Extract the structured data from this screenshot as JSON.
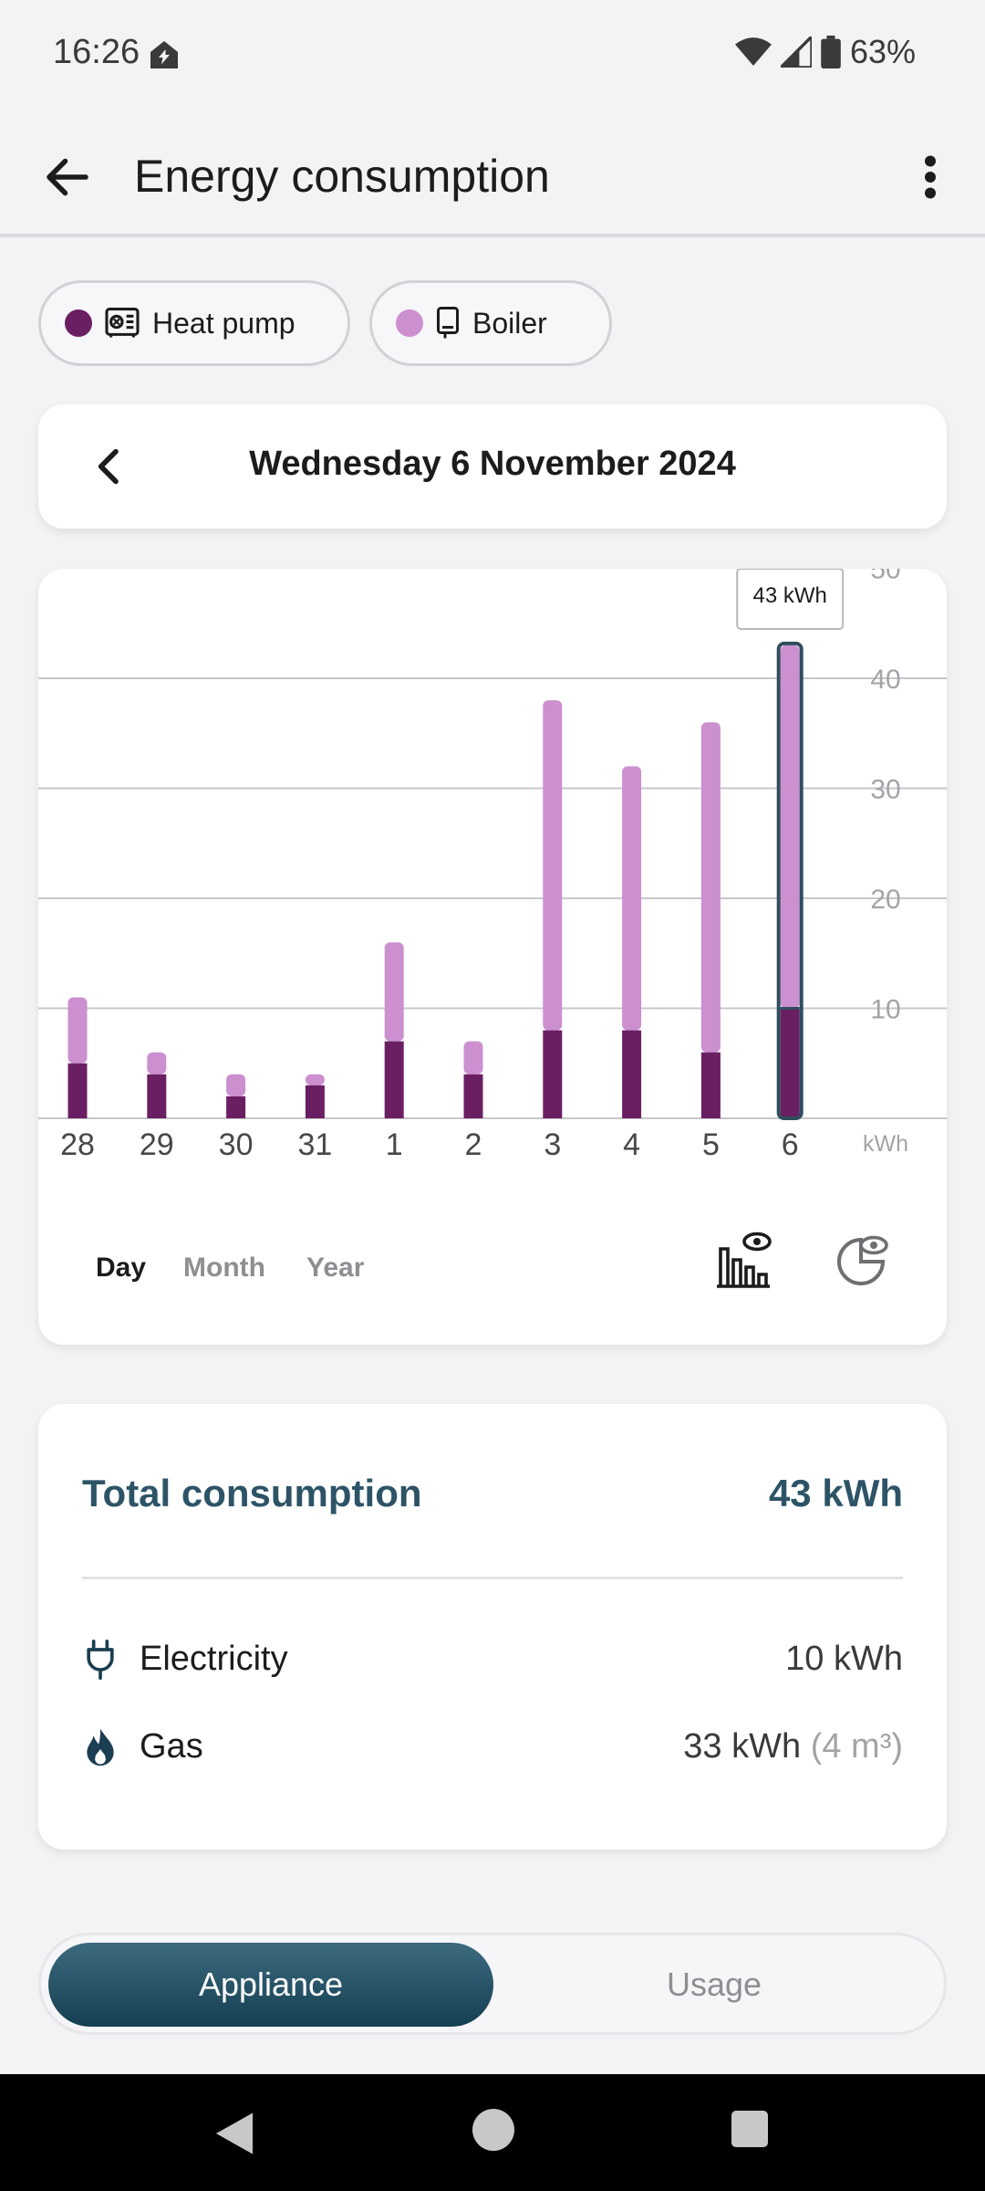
{
  "status_bar": {
    "time": "16:26",
    "battery": "63%",
    "icons": [
      "app-notification-icon",
      "wifi-icon",
      "signal-icon",
      "battery-icon"
    ]
  },
  "header": {
    "title": "Energy consumption",
    "icons": [
      "back-arrow-icon",
      "more-vert-icon"
    ]
  },
  "filters": [
    {
      "label": "Heat pump",
      "color": "#6b1f63",
      "icon": "heat-pump-icon"
    },
    {
      "label": "Boiler",
      "color": "#cc8fd0",
      "icon": "boiler-icon"
    }
  ],
  "date_nav": {
    "title": "Wednesday 6 November 2024"
  },
  "chart_data": {
    "type": "bar",
    "stacked": true,
    "categories": [
      "28",
      "29",
      "30",
      "31",
      "1",
      "2",
      "3",
      "4",
      "5",
      "6"
    ],
    "series": [
      {
        "name": "Heat pump",
        "color": "#6b1f63",
        "values": [
          5,
          4,
          2,
          3,
          7,
          4,
          8,
          8,
          6,
          10
        ]
      },
      {
        "name": "Boiler",
        "color": "#cc8fd0",
        "values": [
          6,
          2,
          2,
          1,
          9,
          3,
          30,
          24,
          30,
          33
        ]
      }
    ],
    "ylim": [
      0,
      50
    ],
    "y_ticks": [
      "10",
      "20",
      "30",
      "40",
      "50"
    ],
    "unit_label": "kWh",
    "grid": true,
    "selected_index": 9,
    "tooltip": "43 kWh"
  },
  "period_tabs": [
    {
      "label": "Day",
      "active": true
    },
    {
      "label": "Month",
      "active": false
    },
    {
      "label": "Year",
      "active": false
    }
  ],
  "view_icons": [
    "bar-chart-view-icon",
    "pie-chart-view-icon"
  ],
  "summary": {
    "total_label": "Total consumption",
    "total_value": "43 kWh",
    "rows": [
      {
        "label": "Electricity",
        "value": "10 kWh",
        "extra": "",
        "icon": "plug-icon"
      },
      {
        "label": "Gas",
        "value": "33 kWh",
        "extra": "(4 m³)",
        "icon": "flame-icon"
      }
    ]
  },
  "segment": {
    "active": "Appliance",
    "inactive": "Usage"
  },
  "colors": {
    "accent": "#2d5466",
    "heat_pump": "#6b1f63",
    "boiler": "#cc8fd0"
  }
}
